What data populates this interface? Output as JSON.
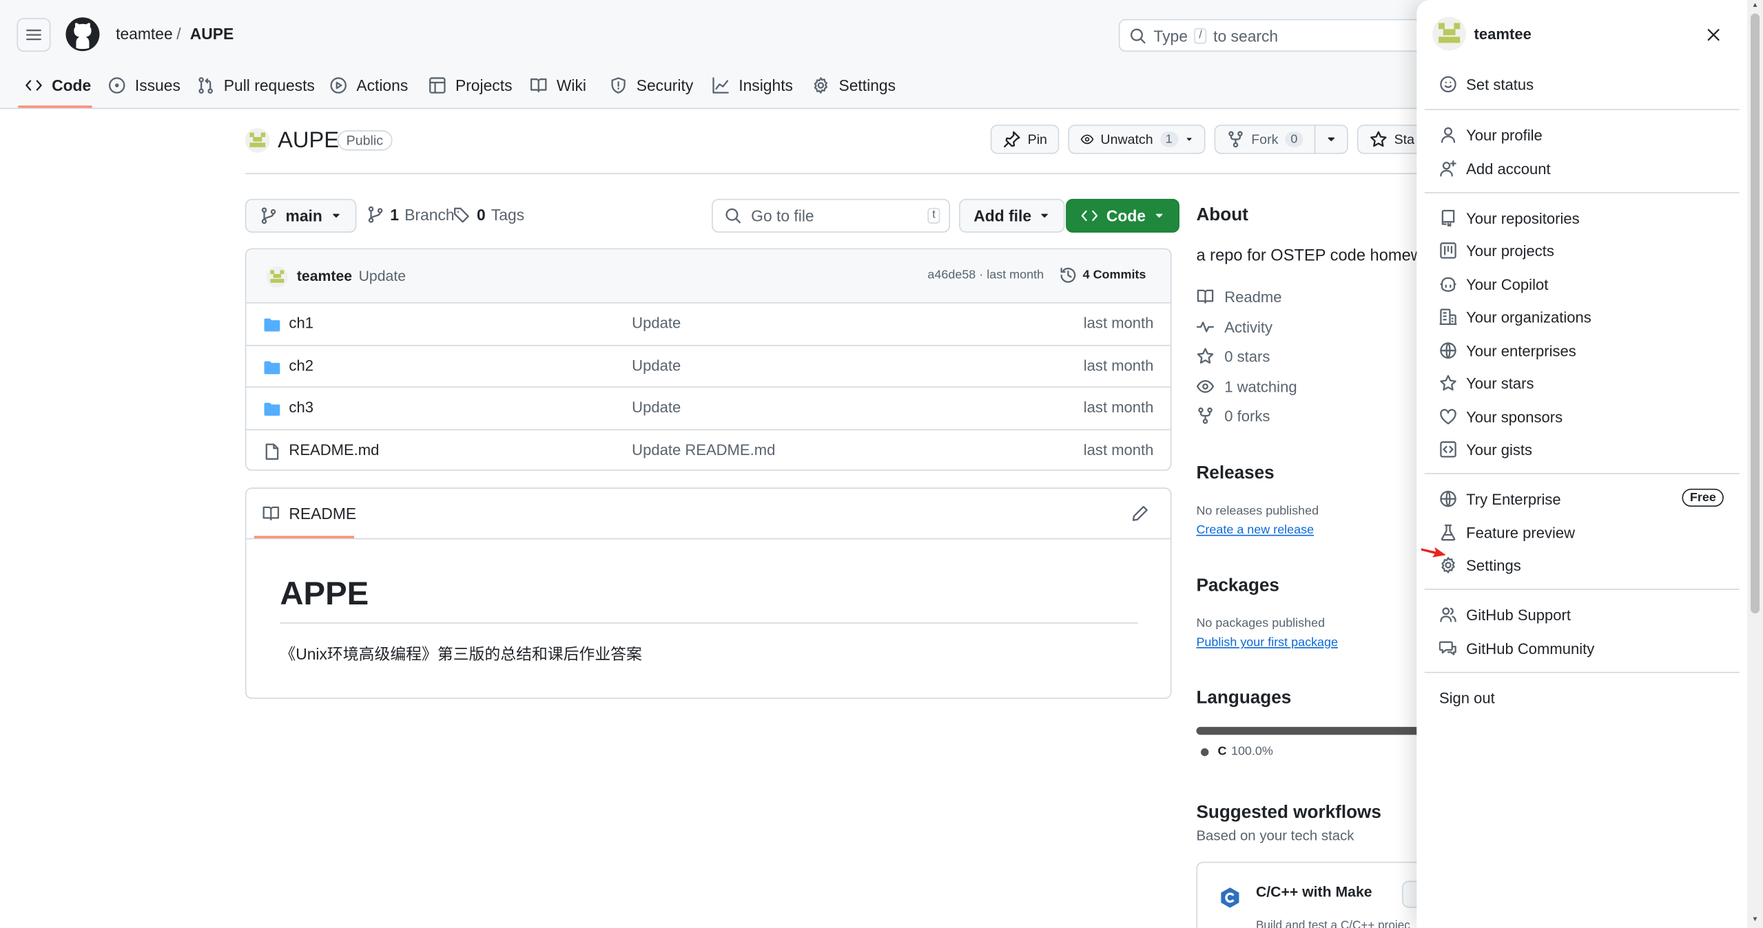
{
  "header": {
    "owner": "teamtee",
    "slash": "/",
    "repo": "AUPE",
    "search_prefix": "Type",
    "search_key": "/",
    "search_suffix": "to search"
  },
  "tabs": [
    "Code",
    "Issues",
    "Pull requests",
    "Actions",
    "Projects",
    "Wiki",
    "Security",
    "Insights",
    "Settings"
  ],
  "repo": {
    "name": "AUPE",
    "visibility": "Public",
    "pin": "Pin",
    "unwatch": "Unwatch",
    "watch_count": "1",
    "fork": "Fork",
    "fork_count": "0",
    "star": "Sta"
  },
  "filenav": {
    "branch": "main",
    "branch_count": "1",
    "branch_label": "Branch",
    "tag_count": "0",
    "tag_label": "Tags",
    "goto_placeholder": "Go to file",
    "goto_key": "t",
    "add_file": "Add file",
    "code": "Code"
  },
  "commit": {
    "author": "teamtee",
    "message": "Update",
    "meta": "a46de58 · last month",
    "commits": "4 Commits"
  },
  "files": [
    {
      "name": "ch1",
      "type": "dir",
      "message": "Update",
      "time": "last month"
    },
    {
      "name": "ch2",
      "type": "dir",
      "message": "Update",
      "time": "last month"
    },
    {
      "name": "ch3",
      "type": "dir",
      "message": "Update",
      "time": "last month"
    },
    {
      "name": "README.md",
      "type": "file",
      "message": "Update README.md",
      "time": "last month"
    }
  ],
  "readme": {
    "tab": "README",
    "heading": "APPE",
    "text": "《Unix环境高级编程》第三版的总结和课后作业答案"
  },
  "about": {
    "title": "About",
    "description": "a repo for OSTEP code homew",
    "readme": "Readme",
    "activity": "Activity",
    "stars": "0 stars",
    "watching": "1 watching",
    "forks": "0 forks"
  },
  "releases": {
    "title": "Releases",
    "none": "No releases published",
    "link": "Create a new release"
  },
  "packages": {
    "title": "Packages",
    "none": "No packages published",
    "link": "Publish your first package"
  },
  "languages": {
    "title": "Languages",
    "entry": "C",
    "percent": "100.0%",
    "color": "#555555"
  },
  "workflows": {
    "title": "Suggested workflows",
    "subtitle": "Based on your tech stack",
    "card_title": "C/C++ with Make",
    "card_text": "Build and test a C/C++ projec"
  },
  "menu": {
    "username": "teamtee",
    "set_status": "Set status",
    "profile": "Your profile",
    "add_account": "Add account",
    "repositories": "Your repositories",
    "projects": "Your projects",
    "copilot": "Your Copilot",
    "organizations": "Your organizations",
    "enterprises": "Your enterprises",
    "stars": "Your stars",
    "sponsors": "Your sponsors",
    "gists": "Your gists",
    "try_enterprise": "Try Enterprise",
    "free_badge": "Free",
    "feature_preview": "Feature preview",
    "settings": "Settings",
    "support": "GitHub Support",
    "community": "GitHub Community",
    "sign_out": "Sign out"
  },
  "colors": {
    "accent_green": "#1f883d",
    "tab_underline": "#fd8c73",
    "folder": "#54aeff",
    "link": "#0969da",
    "arrow": "#e5261f"
  }
}
